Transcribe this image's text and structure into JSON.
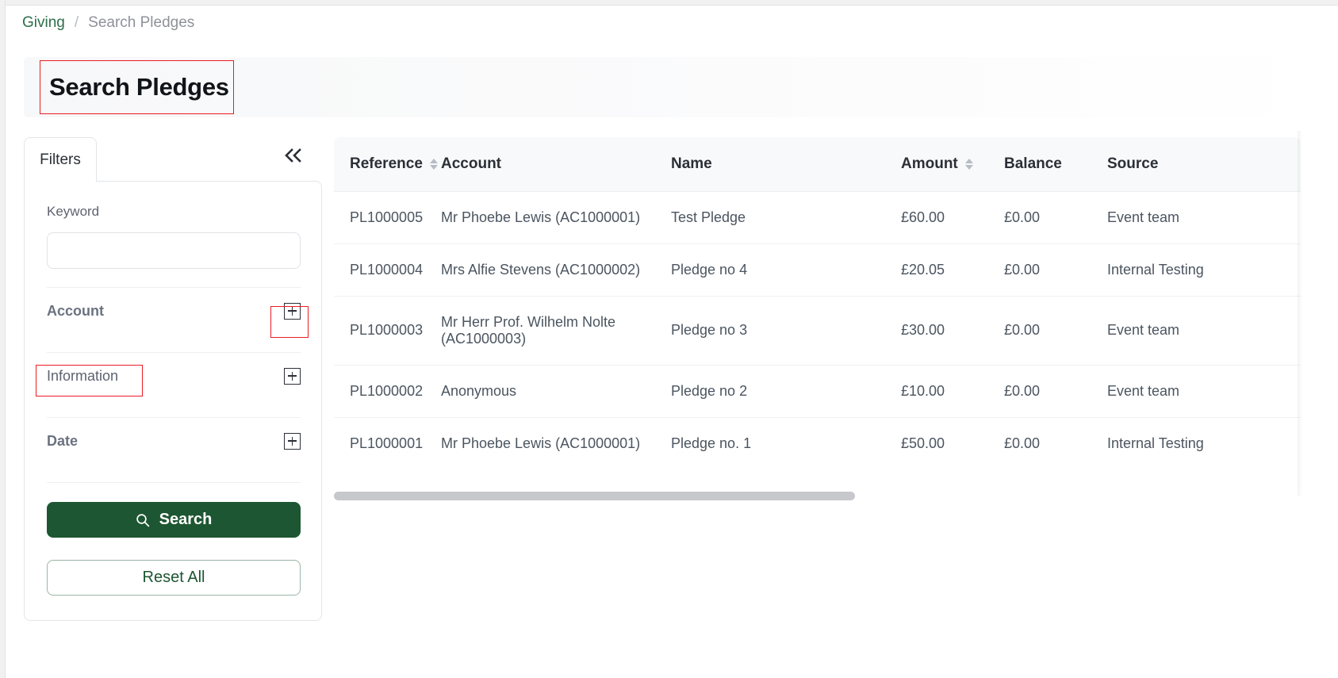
{
  "breadcrumb": {
    "parent": "Giving",
    "separator": "/",
    "current": "Search Pledges"
  },
  "page": {
    "title": "Search Pledges"
  },
  "filters": {
    "tab_label": "Filters",
    "collapse_icon": "double-chevron-left-icon",
    "keyword": {
      "label": "Keyword",
      "value": "",
      "placeholder": ""
    },
    "sections": [
      {
        "label": "Account",
        "expand_icon": "plus-box-icon",
        "highlighted_icon": true
      },
      {
        "label": "Information",
        "expand_icon": "plus-box-icon",
        "highlighted_label": true
      },
      {
        "label": "Date",
        "expand_icon": "plus-box-icon"
      }
    ],
    "search_button": {
      "label": "Search",
      "icon": "search-icon"
    },
    "reset_button": {
      "label": "Reset All"
    }
  },
  "table": {
    "columns": [
      {
        "label": "Reference",
        "sortable": true
      },
      {
        "label": "Account",
        "sortable": false
      },
      {
        "label": "Name",
        "sortable": false
      },
      {
        "label": "Amount",
        "sortable": true
      },
      {
        "label": "Balance",
        "sortable": false
      },
      {
        "label": "Source",
        "sortable": false
      }
    ],
    "rows": [
      {
        "reference": "PL1000005",
        "account": "Mr Phoebe Lewis (AC1000001)",
        "name": "Test Pledge",
        "amount": "£60.00",
        "balance": "£0.00",
        "source": "Event team"
      },
      {
        "reference": "PL1000004",
        "account": "Mrs Alfie Stevens (AC1000002)",
        "name": "Pledge no 4",
        "amount": "£20.05",
        "balance": "£0.00",
        "source": "Internal Testing"
      },
      {
        "reference": "PL1000003",
        "account": "Mr Herr Prof. Wilhelm Nolte (AC1000003)",
        "name": "Pledge no 3",
        "amount": "£30.00",
        "balance": "£0.00",
        "source": "Event team"
      },
      {
        "reference": "PL1000002",
        "account": "Anonymous",
        "name": "Pledge no 2",
        "amount": "£10.00",
        "balance": "£0.00",
        "source": "Event team"
      },
      {
        "reference": "PL1000001",
        "account": "Mr Phoebe Lewis (AC1000001)",
        "name": "Pledge no. 1",
        "amount": "£50.00",
        "balance": "£0.00",
        "source": "Internal Testing"
      }
    ]
  },
  "colors": {
    "brand_green": "#1d5632",
    "link_green": "#2c6e49",
    "highlight_red": "#ec1c24",
    "header_bg": "#f8f9fa"
  }
}
